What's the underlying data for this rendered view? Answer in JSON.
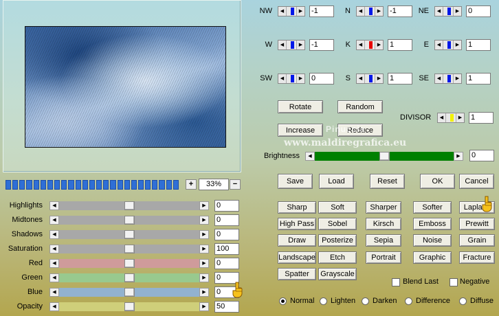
{
  "preview": {
    "zoom": "33%",
    "zoom_in": "+",
    "zoom_out": "−",
    "progress_segments": 25
  },
  "sliders": [
    {
      "label": "Highlights",
      "value": "0",
      "track": "#a8a8a8",
      "level": 0.5
    },
    {
      "label": "Midtones",
      "value": "0",
      "track": "#a8a8a8",
      "level": 0.5
    },
    {
      "label": "Shadows",
      "value": "0",
      "track": "#a8a8a8",
      "level": 0.5
    },
    {
      "label": "Saturation",
      "value": "100",
      "track": "#a8a8a8",
      "level": 0.5
    },
    {
      "label": "Red",
      "value": "0",
      "track": "#cf9b9b",
      "level": 0.5
    },
    {
      "label": "Green",
      "value": "0",
      "track": "#98c98e",
      "level": 0.5
    },
    {
      "label": "Blue",
      "value": "0",
      "track": "#92b2cf",
      "level": 0.5
    },
    {
      "label": "Opacity",
      "value": "50",
      "track": "#cfcf7a",
      "level": 0.5
    }
  ],
  "matrix": [
    {
      "label": "NW",
      "value": "-1"
    },
    {
      "label": "N",
      "value": "-1"
    },
    {
      "label": "NE",
      "value": "0"
    },
    {
      "label": "W",
      "value": "-1"
    },
    {
      "label": "K",
      "value": "1"
    },
    {
      "label": "E",
      "value": "1"
    },
    {
      "label": "SW",
      "value": "0"
    },
    {
      "label": "S",
      "value": "1"
    },
    {
      "label": "SE",
      "value": "1"
    }
  ],
  "buttons": {
    "rotate": "Rotate",
    "random": "Random",
    "increase": "Increase",
    "reduce": "Reduce",
    "save": "Save",
    "load": "Load",
    "reset": "Reset",
    "ok": "OK",
    "cancel": "Cancel"
  },
  "divisor": {
    "label": "DIVISOR",
    "value": "1"
  },
  "brightness": {
    "label": "Brightness",
    "value": "0",
    "track": "#008000",
    "level": 0.5
  },
  "effects": [
    [
      "Sharp",
      "Soft",
      "Sharper",
      "Softer",
      "Laplace"
    ],
    [
      "High Pass",
      "Sobel",
      "Kirsch",
      "Emboss",
      "Prewitt"
    ],
    [
      "Draw",
      "Posterize",
      "Sepia",
      "Noise",
      "Grain"
    ],
    [
      "Landscape",
      "Etch",
      "Portrait",
      "Graphic",
      "Fracture"
    ],
    [
      "Spatter",
      "Grayscale"
    ]
  ],
  "options": {
    "blend_last": "Blend Last",
    "negative": "Negative"
  },
  "blend_modes": [
    "Normal",
    "Lighten",
    "Darken",
    "Difference",
    "Diffuse"
  ],
  "watermark": {
    "line1": "Pinuccia",
    "line2": "www.maldiregrafica.eu"
  }
}
